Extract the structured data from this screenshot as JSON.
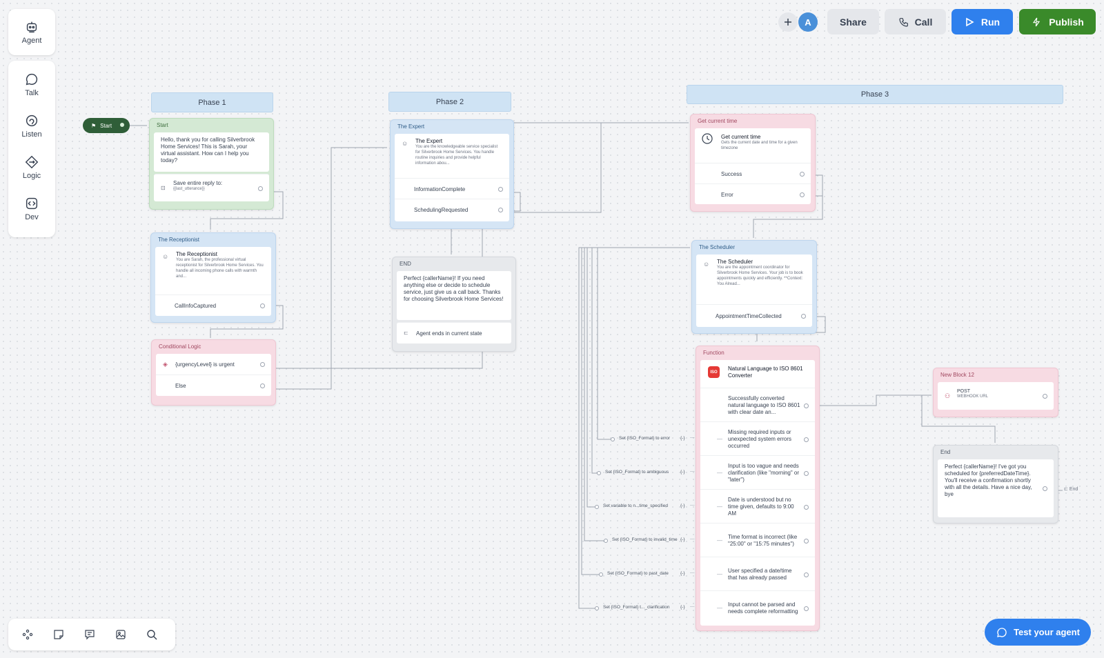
{
  "rail": {
    "agent": "Agent",
    "items": [
      {
        "label": "Talk",
        "icon": "chat-bubble-icon"
      },
      {
        "label": "Listen",
        "icon": "ear-icon"
      },
      {
        "label": "Logic",
        "icon": "logic-diamond-icon"
      },
      {
        "label": "Dev",
        "icon": "code-icon"
      }
    ]
  },
  "topbar": {
    "avatar": "A",
    "share": "Share",
    "call": "Call",
    "run": "Run",
    "publish": "Publish"
  },
  "phases": {
    "p1": "Phase 1",
    "p2": "Phase 2",
    "p3": "Phase 3"
  },
  "start_pill": "Start",
  "nodes": {
    "start": {
      "header": "Start",
      "message": "Hello, thank you for calling Silverbrook Home Services! This is Sarah, your virtual assistant. How can I help you today?",
      "save_label": "Save entire reply to:",
      "save_var": "{{last_utterance}}"
    },
    "receptionist": {
      "header": "The Receptionist",
      "title": "The Receptionist",
      "desc": "You are Sarah, the professional virtual receptionist for Silverbrook Home Services. You handle all incoming phone calls with warmth and...",
      "out1": "CallInfoCaptured"
    },
    "conditional": {
      "header": "Conditional Logic",
      "cond1": "{urgencyLevel} is urgent",
      "cond2": "Else"
    },
    "expert": {
      "header": "The Expert",
      "title": "The Expert",
      "desc": "You are the knowledgeable service specialist for Silverbrook Home Services. You handle routine inquiries and provide helpful information abou...",
      "out1": "InformationComplete",
      "out2": "SchedulingRequested"
    },
    "end_node": {
      "header": "END",
      "message": "Perfect {callerName}! If you need anything else or decide to schedule service, just give us a call back. Thanks for choosing Silverbrook Home Services!",
      "footer": "Agent ends in current state"
    },
    "get_time": {
      "header": "Get current time",
      "title": "Get current time",
      "desc": "Gets the current date and time for a given timezone",
      "out1": "Success",
      "out2": "Error"
    },
    "scheduler": {
      "header": "The Scheduler",
      "title": "The Scheduler",
      "desc": "You are the appointment coordinator for Silverbrook Home Services. Your job is to book appointments quickly and efficiently. **Context: You Alread...",
      "out1": "AppointmentTimeCollected"
    },
    "function": {
      "header": "Function",
      "title": "Natural Language to ISO 8601 Converter",
      "outputs": [
        "Successfully converted natural language to ISO 8601 with clear date an...",
        "Missing required inputs or unexpected system errors occurred",
        "Input is too vague and needs clarification (like \"morning\" or \"later\")",
        "Date is understood but no time given, defaults to 9:00 AM",
        "Time format is incorrect (like \"25:00\" or \"15:75 minutes\")",
        "User specified a date/time that has already passed",
        "Input cannot be parsed and needs complete reformatting"
      ],
      "set_labels": [
        "Set {ISO_Format} to error",
        "Set {ISO_Format} to ambiguous",
        "Set variable to n...time_specified",
        "Set {ISO_Format} to invalid_time",
        "Set {ISO_Format} to past_date",
        "Set {ISO_Format} t..._clarification"
      ]
    },
    "block12": {
      "header": "New Block 12",
      "method": "POST",
      "url": "WEBHOOK URL"
    },
    "end2": {
      "header": "End",
      "message": "Perfect {callerName}! I've got you scheduled for {preferredDateTime}. You'll receive a confirmation shortly with all the details. Have a nice day, bye",
      "end_label": "End"
    }
  },
  "test_agent": "Test your agent",
  "colors": {
    "run": "#2f80ed",
    "publish": "#3a8a2a",
    "start_pill": "#2f5e38",
    "test": "#2f80ed"
  }
}
